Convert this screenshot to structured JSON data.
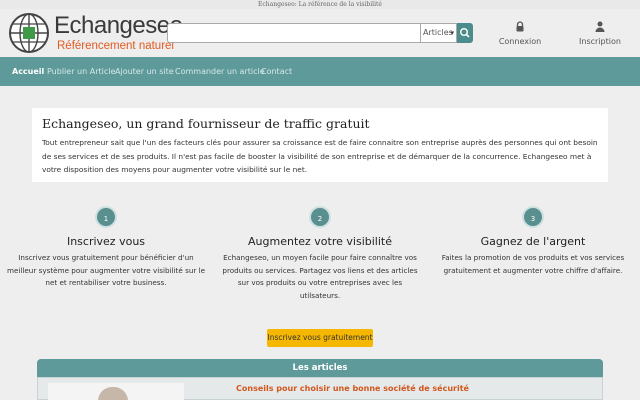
{
  "top_tagline": "Echangeseo: La référence de la visibilité",
  "logo": {
    "title": "Echangeseo",
    "subtitle": "Référencement naturel",
    "icon": "globe-icon"
  },
  "search": {
    "value": "",
    "placeholder": "",
    "select_value": "Articles",
    "button_icon": "search-icon"
  },
  "account": {
    "login_label": "Connexion",
    "login_icon": "lock-icon",
    "signup_label": "Inscription",
    "signup_icon": "user-icon"
  },
  "nav": {
    "items": [
      {
        "label": "Accueil",
        "active": true
      },
      {
        "label": "Publier un Article"
      },
      {
        "label": "Ajouter un site"
      },
      {
        "label": "Commander un article"
      },
      {
        "label": "Contact"
      }
    ]
  },
  "intro": {
    "title": "Echangeseo, un grand fournisseur de traffic gratuit",
    "body": "Tout entrepreneur sait que l'un des facteurs clés pour assurer sa croissance est de faire connaitre son entreprise auprès des personnes qui ont besoin de ses services et de ses produits. Il n'est pas facile de booster la visibilité de son entreprise et de démarquer de la concurrence. Echangeseo met à votre disposition des moyens pour augmenter votre visibilité sur le net."
  },
  "steps": [
    {
      "number": "1",
      "title": "Inscrivez vous",
      "text": "Inscrivez vous gratuitement pour bénéficier d'un meilleur système pour augmenter votre visibilité sur le net et rentabiliser votre business."
    },
    {
      "number": "2",
      "title": "Augmentez votre visibilité",
      "text": "Echangeseo, un moyen facile pour faire connaître vos produits ou services. Partagez vos liens et des articles sur vos produits ou votre entreprises avec les utilsateurs."
    },
    {
      "number": "3",
      "title": "Gagnez de l'argent",
      "text": "Faites la promotion de vos produits et vos services gratuitement et augmenter votre chiffre d'affaire."
    }
  ],
  "cta_label": "Inscrivez vous gratuitement",
  "articles": {
    "heading": "Les articles",
    "first_title": "Conseils pour choisir une bonne société de sécurité"
  },
  "colors": {
    "nav": "#5e9a9a",
    "accent": "#e35a20",
    "cta": "#f5b700",
    "badge": "#5a8f8f"
  }
}
